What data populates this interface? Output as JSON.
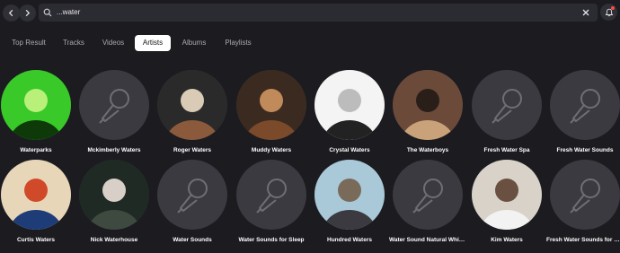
{
  "search": {
    "query": "...water"
  },
  "tabs": [
    {
      "label": "Top Result"
    },
    {
      "label": "Tracks"
    },
    {
      "label": "Videos"
    },
    {
      "label": "Artists"
    },
    {
      "label": "Albums"
    },
    {
      "label": "Playlists"
    }
  ],
  "active_tab": "Artists",
  "artists": [
    {
      "name": "Waterparks",
      "image": "photo"
    },
    {
      "name": "Mckimberly Waters",
      "image": "placeholder"
    },
    {
      "name": "Roger Waters",
      "image": "photo"
    },
    {
      "name": "Muddy Waters",
      "image": "photo"
    },
    {
      "name": "Crystal Waters",
      "image": "photo"
    },
    {
      "name": "The Waterboys",
      "image": "photo"
    },
    {
      "name": "Fresh Water Spa",
      "image": "placeholder"
    },
    {
      "name": "Fresh Water Sounds",
      "image": "placeholder"
    },
    {
      "name": "Curtis Waters",
      "image": "photo"
    },
    {
      "name": "Nick Waterhouse",
      "image": "photo"
    },
    {
      "name": "Water Sounds",
      "image": "placeholder"
    },
    {
      "name": "Water Sounds for Sleep",
      "image": "placeholder"
    },
    {
      "name": "Hundred Waters",
      "image": "photo"
    },
    {
      "name": "Water Sound Natural White Noise",
      "image": "placeholder"
    },
    {
      "name": "Kim Waters",
      "image": "photo"
    },
    {
      "name": "Fresh Water Sounds for Sleep",
      "image": "placeholder"
    }
  ],
  "colors": {
    "background": "#1b1b20",
    "placeholder_circle": "#3a3a40",
    "placeholder_icon": "#6e6e76",
    "active_tab_bg": "#ffffff",
    "notification_dot": "#ff4a4a"
  }
}
